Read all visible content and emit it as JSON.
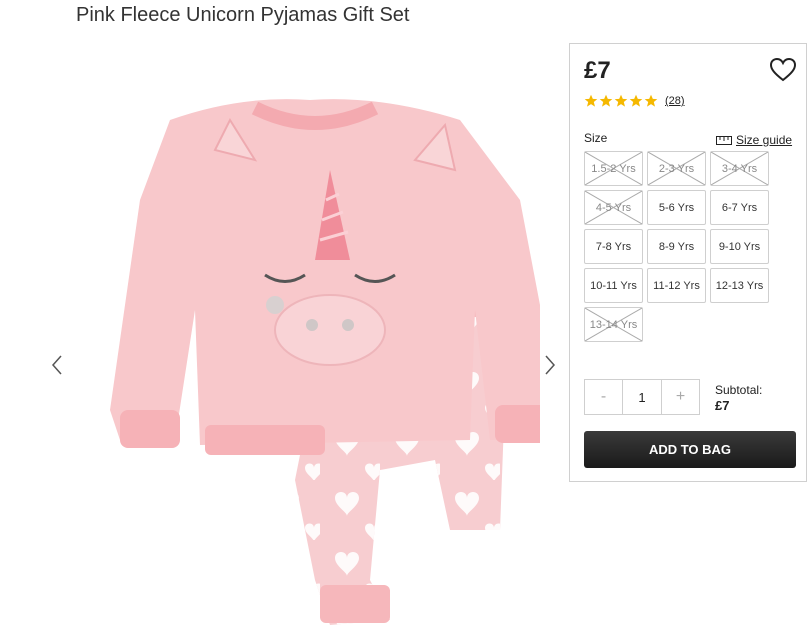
{
  "product": {
    "title": "Pink Fleece Unicorn Pyjamas Gift Set",
    "price": "£7",
    "rating_stars": 5,
    "review_count": "(28)",
    "star_color": "#f5b800"
  },
  "size_section": {
    "label": "Size",
    "guide_label": "Size guide",
    "sizes": [
      {
        "label": "1.5-2 Yrs",
        "available": false
      },
      {
        "label": "2-3 Yrs",
        "available": false
      },
      {
        "label": "3-4 Yrs",
        "available": false
      },
      {
        "label": "4-5 Yrs",
        "available": false
      },
      {
        "label": "5-6 Yrs",
        "available": true
      },
      {
        "label": "6-7 Yrs",
        "available": true
      },
      {
        "label": "7-8 Yrs",
        "available": true
      },
      {
        "label": "8-9 Yrs",
        "available": true
      },
      {
        "label": "9-10 Yrs",
        "available": true
      },
      {
        "label": "10-11 Yrs",
        "available": true
      },
      {
        "label": "11-12 Yrs",
        "available": true
      },
      {
        "label": "12-13 Yrs",
        "available": true
      },
      {
        "label": "13-14 Yrs",
        "available": false
      }
    ]
  },
  "quantity": {
    "minus": "-",
    "value": "1",
    "plus": "+"
  },
  "subtotal": {
    "label": "Subtotal:",
    "value": "£7"
  },
  "add_to_bag": "ADD TO BAG",
  "icons": {
    "wishlist": "heart-outline-icon",
    "size_guide": "ruler-icon",
    "prev": "chevron-left-icon",
    "next": "chevron-right-icon"
  }
}
